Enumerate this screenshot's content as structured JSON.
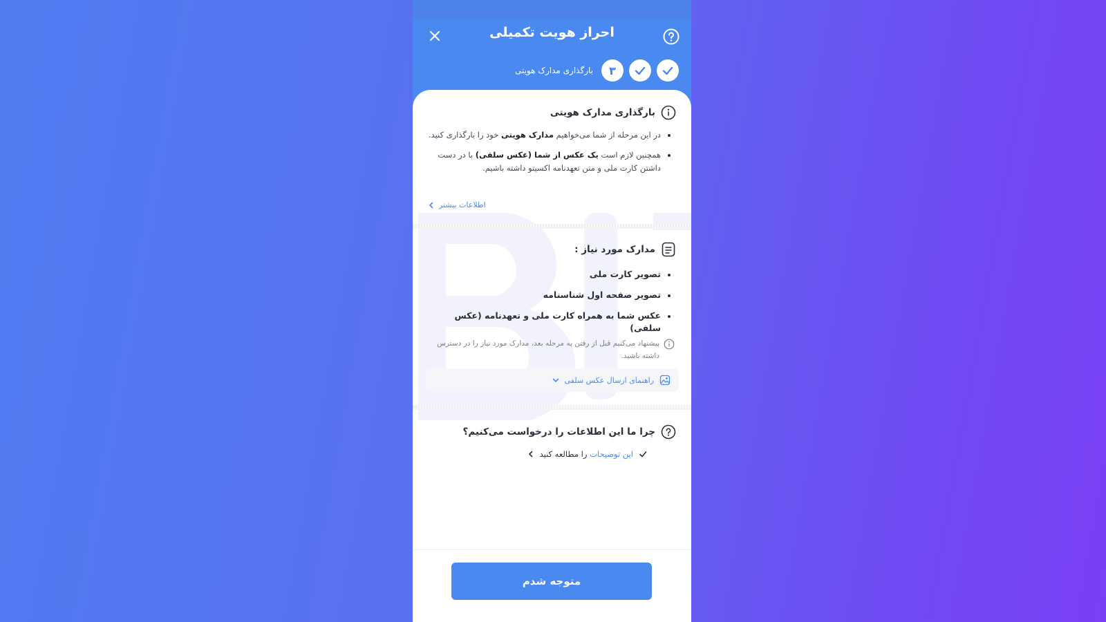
{
  "header": {
    "title": "احراز هویت تکمیلی",
    "step_current": "۳",
    "step_label": "بارگذاری مدارک هویتی"
  },
  "intro": {
    "title": "بارگذاری مدارک هویتی",
    "b1_pre": "در این مرحله از شما می‌خواهیم ",
    "b1_bold": "مدارک هویتی",
    "b1_post": " خود را بارگذاری کنید.",
    "b2_pre": "همچنین لازم است ",
    "b2_bold": "یک عکس از شما (عکس سلفی)",
    "b2_post": " با در دست داشتن کارت ملی و متن تعهدنامه اکسیتو داشته باشیم.",
    "more_link": "اطلاعات بیشتر"
  },
  "docs": {
    "title": "مدارک مورد نیاز :",
    "items": [
      "تصویر کارت ملی",
      "تصویر صفحه اول شناسنامه",
      "عکس شما به همراه کارت ملی و تعهدنامه (عکس سلفی)"
    ],
    "note": "پیشنهاد می‌کنیم قبل از رفتن به مرحله بعد، مدارک مورد نیاز را در دسترس داشته باشید.",
    "guide": "راهنمای ارسال عکس سلفی"
  },
  "why": {
    "title": "چرا ما این اطلاعات را درخواست می‌کنیم؟",
    "link_blue": "این توضیحات",
    "link_rest": " را مطالعه کنید"
  },
  "footer": {
    "button": "متوجه شدم"
  },
  "colors": {
    "primary": "#4a8af0",
    "text": "#2b2f38"
  }
}
